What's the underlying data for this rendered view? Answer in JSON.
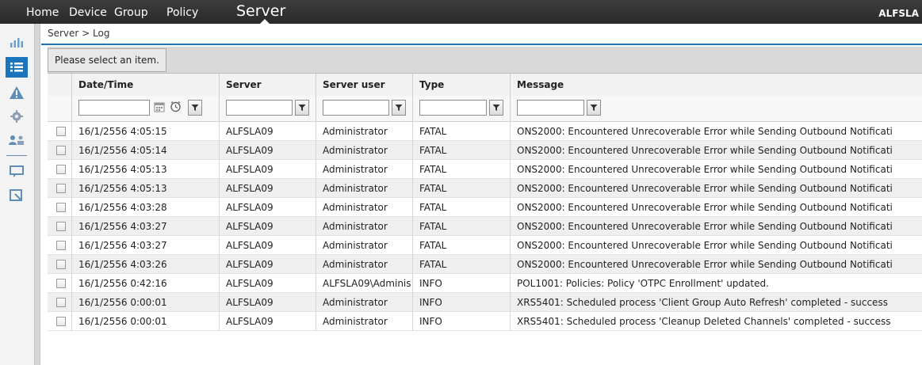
{
  "nav": {
    "items": [
      "Home",
      "Device",
      "Group",
      "Policy"
    ],
    "active": "Server",
    "user": "ALFSLA"
  },
  "breadcrumb": "Server > Log",
  "toolbar": {
    "message": "Please select an item."
  },
  "columns": [
    "Date/Time",
    "Server",
    "Server user",
    "Type",
    "Message"
  ],
  "rows": [
    {
      "datetime": "16/1/2556 4:05:15",
      "server": "ALFSLA09",
      "user": "Administrator",
      "type": "FATAL",
      "message": "ONS2000: Encountered Unrecoverable Error while Sending Outbound Notificati"
    },
    {
      "datetime": "16/1/2556 4:05:14",
      "server": "ALFSLA09",
      "user": "Administrator",
      "type": "FATAL",
      "message": "ONS2000: Encountered Unrecoverable Error while Sending Outbound Notificati"
    },
    {
      "datetime": "16/1/2556 4:05:13",
      "server": "ALFSLA09",
      "user": "Administrator",
      "type": "FATAL",
      "message": "ONS2000: Encountered Unrecoverable Error while Sending Outbound Notificati"
    },
    {
      "datetime": "16/1/2556 4:05:13",
      "server": "ALFSLA09",
      "user": "Administrator",
      "type": "FATAL",
      "message": "ONS2000: Encountered Unrecoverable Error while Sending Outbound Notificati"
    },
    {
      "datetime": "16/1/2556 4:03:28",
      "server": "ALFSLA09",
      "user": "Administrator",
      "type": "FATAL",
      "message": "ONS2000: Encountered Unrecoverable Error while Sending Outbound Notificati"
    },
    {
      "datetime": "16/1/2556 4:03:27",
      "server": "ALFSLA09",
      "user": "Administrator",
      "type": "FATAL",
      "message": "ONS2000: Encountered Unrecoverable Error while Sending Outbound Notificati"
    },
    {
      "datetime": "16/1/2556 4:03:27",
      "server": "ALFSLA09",
      "user": "Administrator",
      "type": "FATAL",
      "message": "ONS2000: Encountered Unrecoverable Error while Sending Outbound Notificati"
    },
    {
      "datetime": "16/1/2556 4:03:26",
      "server": "ALFSLA09",
      "user": "Administrator",
      "type": "FATAL",
      "message": "ONS2000: Encountered Unrecoverable Error while Sending Outbound Notificati"
    },
    {
      "datetime": "16/1/2556 0:42:16",
      "server": "ALFSLA09",
      "user": "ALFSLA09\\Adminis",
      "type": "INFO",
      "message": "POL1001: Policies: Policy 'OTPC Enrollment' updated."
    },
    {
      "datetime": "16/1/2556 0:00:01",
      "server": "ALFSLA09",
      "user": "Administrator",
      "type": "INFO",
      "message": "XRS5401: Scheduled process 'Client Group Auto Refresh' completed - success"
    },
    {
      "datetime": "16/1/2556 0:00:01",
      "server": "ALFSLA09",
      "user": "Administrator",
      "type": "INFO",
      "message": "XRS5401: Scheduled process 'Cleanup Deleted Channels' completed - success"
    }
  ],
  "colors": {
    "accent": "#1b75bc",
    "nav_bg": "#2f2f2f"
  },
  "icons": [
    "chart-icon",
    "list-icon",
    "warning-icon",
    "gear-icon",
    "users-icon",
    "chat-icon",
    "export-icon",
    "calendar-icon",
    "clock-icon",
    "filter-icon"
  ]
}
